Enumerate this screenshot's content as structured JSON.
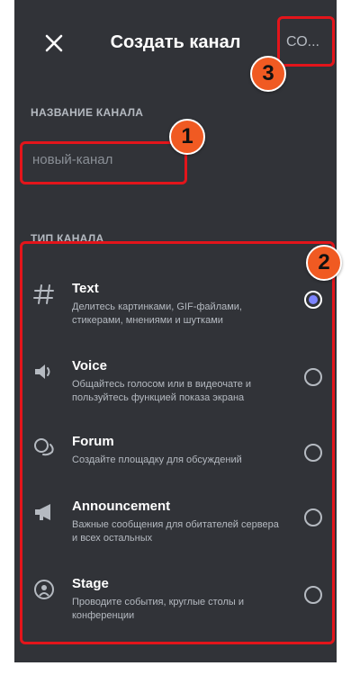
{
  "header": {
    "title": "Создать канал",
    "create_label": "СО..."
  },
  "name_section": {
    "label": "НАЗВАНИЕ КАНАЛА",
    "placeholder": "новый-канал"
  },
  "type_section": {
    "label": "ТИП КАНАЛА",
    "items": [
      {
        "name": "Text",
        "desc": "Делитесь картинками, GIF-файлами, стикерами, мнениями и шутками",
        "icon": "hash-icon",
        "selected": true
      },
      {
        "name": "Voice",
        "desc": "Общайтесь голосом или в видеочате и пользуйтесь функцией показа экрана",
        "icon": "speaker-icon",
        "selected": false
      },
      {
        "name": "Forum",
        "desc": "Создайте площадку для обсуждений",
        "icon": "forum-icon",
        "selected": false
      },
      {
        "name": "Announcement",
        "desc": "Важные сообщения для обитателей сервера и всех остальных",
        "icon": "megaphone-icon",
        "selected": false
      },
      {
        "name": "Stage",
        "desc": "Проводите события, круглые столы и конференции",
        "icon": "stage-icon",
        "selected": false
      }
    ]
  },
  "annotations": [
    "1",
    "2",
    "3"
  ],
  "colors": {
    "background": "#313338",
    "accent": "#7d84ff",
    "annotation": "#e3151b",
    "badge": "#f05a22"
  }
}
